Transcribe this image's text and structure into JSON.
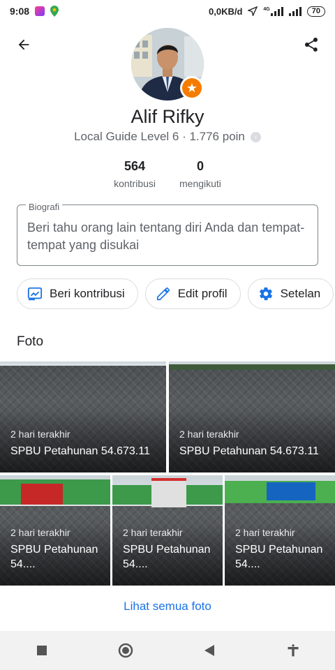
{
  "status_bar": {
    "time": "9:08",
    "network_speed": "0,0KB/d",
    "signal_label": "4G",
    "battery": "70"
  },
  "header": {
    "back_icon": "arrow-left-icon",
    "share_icon": "share-icon"
  },
  "profile": {
    "name": "Alif Rifky",
    "level_text": "Local Guide Level 6 · 1.776 poin",
    "stats": [
      {
        "value": "564",
        "label": "kontribusi"
      },
      {
        "value": "0",
        "label": "mengikuti"
      }
    ]
  },
  "bio": {
    "label": "Biografi",
    "placeholder": "Beri tahu orang lain tentang diri Anda dan tempat-tempat yang disukai"
  },
  "actions": [
    {
      "label": "Beri kontribusi",
      "icon": "contribute-icon"
    },
    {
      "label": "Edit profil",
      "icon": "pencil-icon"
    },
    {
      "label": "Setelan",
      "icon": "gear-icon"
    }
  ],
  "photos": {
    "section_title": "Foto",
    "items": [
      {
        "time": "2 hari terakhir",
        "title": "SPBU Petahunan 54.673.11"
      },
      {
        "time": "2 hari terakhir",
        "title": "SPBU Petahunan 54.673.11"
      },
      {
        "time": "2 hari terakhir",
        "title": "SPBU Petahunan 54...."
      },
      {
        "time": "2 hari terakhir",
        "title": "SPBU Petahunan 54...."
      },
      {
        "time": "2 hari terakhir",
        "title": "SPBU Petahunan 54...."
      }
    ],
    "see_all": "Lihat semua foto"
  },
  "colors": {
    "accent": "#1a73e8",
    "badge": "#f57c00",
    "text_primary": "#202124",
    "text_secondary": "#5f6368"
  }
}
